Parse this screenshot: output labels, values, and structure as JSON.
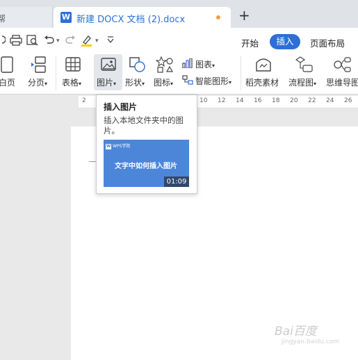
{
  "tabs": {
    "prev_tab_label": "帮",
    "active_tab_label": "新建 DOCX 文档 (2).docx",
    "doc_icon_letter": "W",
    "new_tab_symbol": "+",
    "unsaved_dot_color": "#f0a040"
  },
  "quick_access": {
    "icons": [
      "print-icon",
      "print-preview-icon",
      "undo-icon",
      "redo-icon",
      "highlight-pen-icon",
      "more-dropdown-icon"
    ],
    "dropdown_arrow": "▾"
  },
  "menu": {
    "items": [
      "开始",
      "插入",
      "页面布局"
    ],
    "active": "插入",
    "accent_color": "#2e6fd6"
  },
  "ribbon": {
    "blank_page": "白页",
    "page_break": "分页",
    "table": "表格",
    "picture": "图片",
    "shape": "形状",
    "icon": "图标",
    "chart": "图表",
    "smart_art": "智能图形",
    "materials": "稻壳素材",
    "flowchart": "流程图",
    "mindmap": "思维导图",
    "dropdown_arrow": "▾"
  },
  "ruler": {
    "labels": [
      "2",
      "10",
      "12",
      "14",
      "16",
      "18",
      "20",
      "22",
      "24",
      "26"
    ]
  },
  "tooltip": {
    "title": "插入图片",
    "description": "插入本地文件夹中的图片。",
    "thumb_brand": "WPS学院",
    "thumb_title": "文字中如何插入图片",
    "thumb_duration": "01:09"
  },
  "watermark": {
    "text": "Bai百度",
    "sub": "jingyan.baidu.com"
  }
}
